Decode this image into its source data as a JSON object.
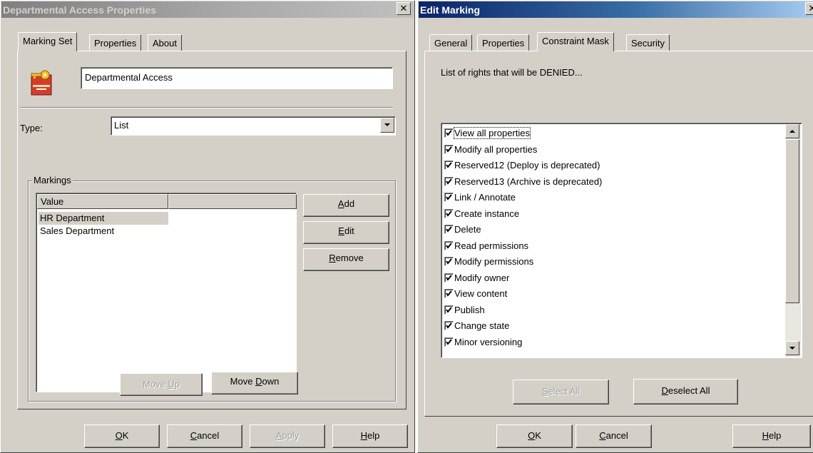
{
  "left_dialog": {
    "title": "Departmental Access Properties",
    "tabs": [
      "Marking Set",
      "Properties",
      "About"
    ],
    "name_value": "Departmental Access",
    "type_label": "Type:",
    "type_value": "List",
    "markings_group": "Markings",
    "columns": [
      "Value",
      ""
    ],
    "rows": [
      "HR Department",
      "Sales Department"
    ],
    "side_buttons": {
      "add": {
        "u": "A",
        "rest": "dd"
      },
      "edit": {
        "u": "E",
        "rest": "dit"
      },
      "remove": {
        "u": "R",
        "rest": "emove"
      }
    },
    "move_up": {
      "pre": "Move ",
      "u": "U",
      "post": "p"
    },
    "move_down": {
      "pre": "Move ",
      "u": "D",
      "post": "own"
    },
    "footer": {
      "ok": {
        "u": "O",
        "rest": "K"
      },
      "cancel": {
        "u": "C",
        "rest": "ancel"
      },
      "apply": {
        "u": "A",
        "rest": "pply"
      },
      "help": {
        "u": "H",
        "rest": "elp"
      }
    }
  },
  "right_dialog": {
    "title": "Edit Marking",
    "tabs": [
      "General",
      "Properties",
      "Constraint Mask",
      "Security"
    ],
    "description": "List of rights that will be DENIED...",
    "rights": [
      "View all properties",
      "Modify all properties",
      "Reserved12 (Deploy is deprecated)",
      "Reserved13 (Archive is deprecated)",
      "Link / Annotate",
      "Create instance",
      "Delete",
      "Read permissions",
      "Modify permissions",
      "Modify owner",
      "View content",
      "Publish",
      "Change state",
      "Minor versioning"
    ],
    "select_all": {
      "u": "S",
      "rest": "elect All"
    },
    "deselect_all": {
      "u": "D",
      "rest": "eselect All"
    },
    "footer": {
      "ok": {
        "u": "O",
        "rest": "K"
      },
      "cancel": {
        "u": "C",
        "rest": "ancel"
      },
      "help": {
        "u": "H",
        "rest": "elp"
      }
    }
  },
  "colors": {
    "face": "#d4d0c8",
    "active_title": "#0a246a",
    "inactive_title": "#808080"
  },
  "icons": [
    "key-icon",
    "close-icon",
    "dropdown-arrow-icon",
    "scroll-up-icon",
    "scroll-down-icon",
    "check-icon"
  ]
}
